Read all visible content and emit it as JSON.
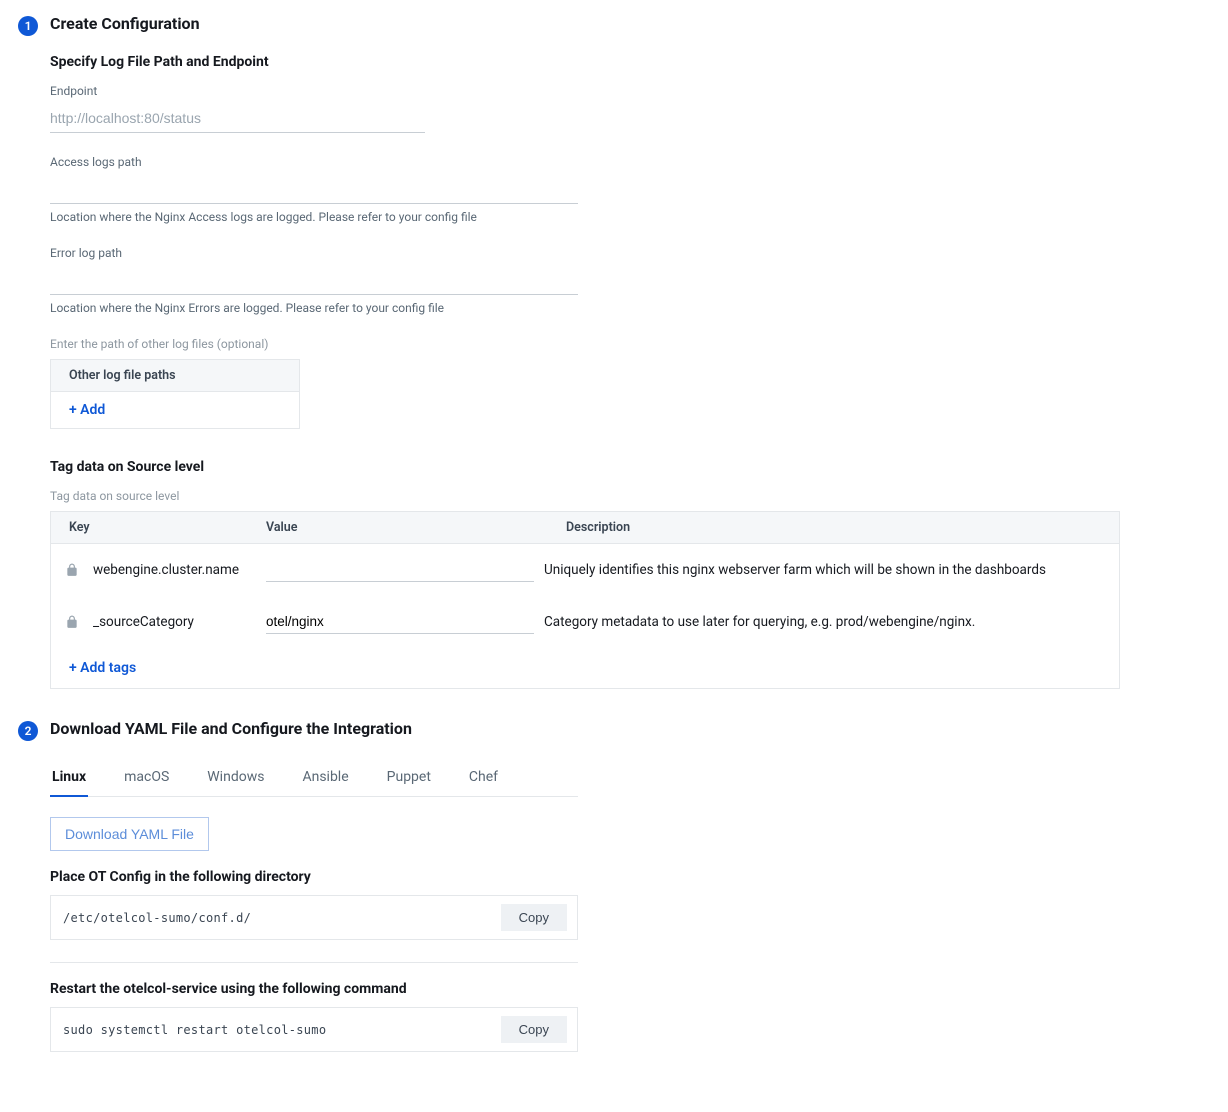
{
  "step1": {
    "num": "1",
    "title": "Create Configuration",
    "subheading": "Specify Log File Path and Endpoint",
    "endpoint": {
      "label": "Endpoint",
      "placeholder": "http://localhost:80/status",
      "value": ""
    },
    "access": {
      "label": "Access logs path",
      "help": "Location where the Nginx Access logs are logged. Please refer to your config file",
      "value": ""
    },
    "error": {
      "label": "Error log path",
      "help": "Location where the Nginx Errors are logged. Please refer to your config file",
      "value": ""
    },
    "other": {
      "label": "Enter the path of other log files (optional)",
      "header": "Other log file paths",
      "add": "+ Add"
    },
    "tag": {
      "heading": "Tag data on Source level",
      "sublabel": "Tag data on source level",
      "cols": {
        "key": "Key",
        "value": "Value",
        "desc": "Description"
      },
      "rows": [
        {
          "key": "webengine.cluster.name",
          "value": "",
          "desc": "Uniquely identifies this nginx webserver farm which will be shown in the dashboards"
        },
        {
          "key": "_sourceCategory",
          "value": "otel/nginx",
          "desc": "Category metadata to use later for querying, e.g. prod/webengine/nginx."
        }
      ],
      "add": "+ Add tags"
    }
  },
  "step2": {
    "num": "2",
    "title": "Download YAML File and Configure the Integration",
    "tabs": [
      "Linux",
      "macOS",
      "Windows",
      "Ansible",
      "Puppet",
      "Chef"
    ],
    "active_tab": 0,
    "download": "Download YAML File",
    "place": {
      "heading": "Place OT Config in the following directory",
      "code": "/etc/otelcol-sumo/conf.d/"
    },
    "restart": {
      "heading": "Restart the otelcol-service using the following command",
      "code": "sudo systemctl restart otelcol-sumo"
    },
    "copy": "Copy"
  }
}
